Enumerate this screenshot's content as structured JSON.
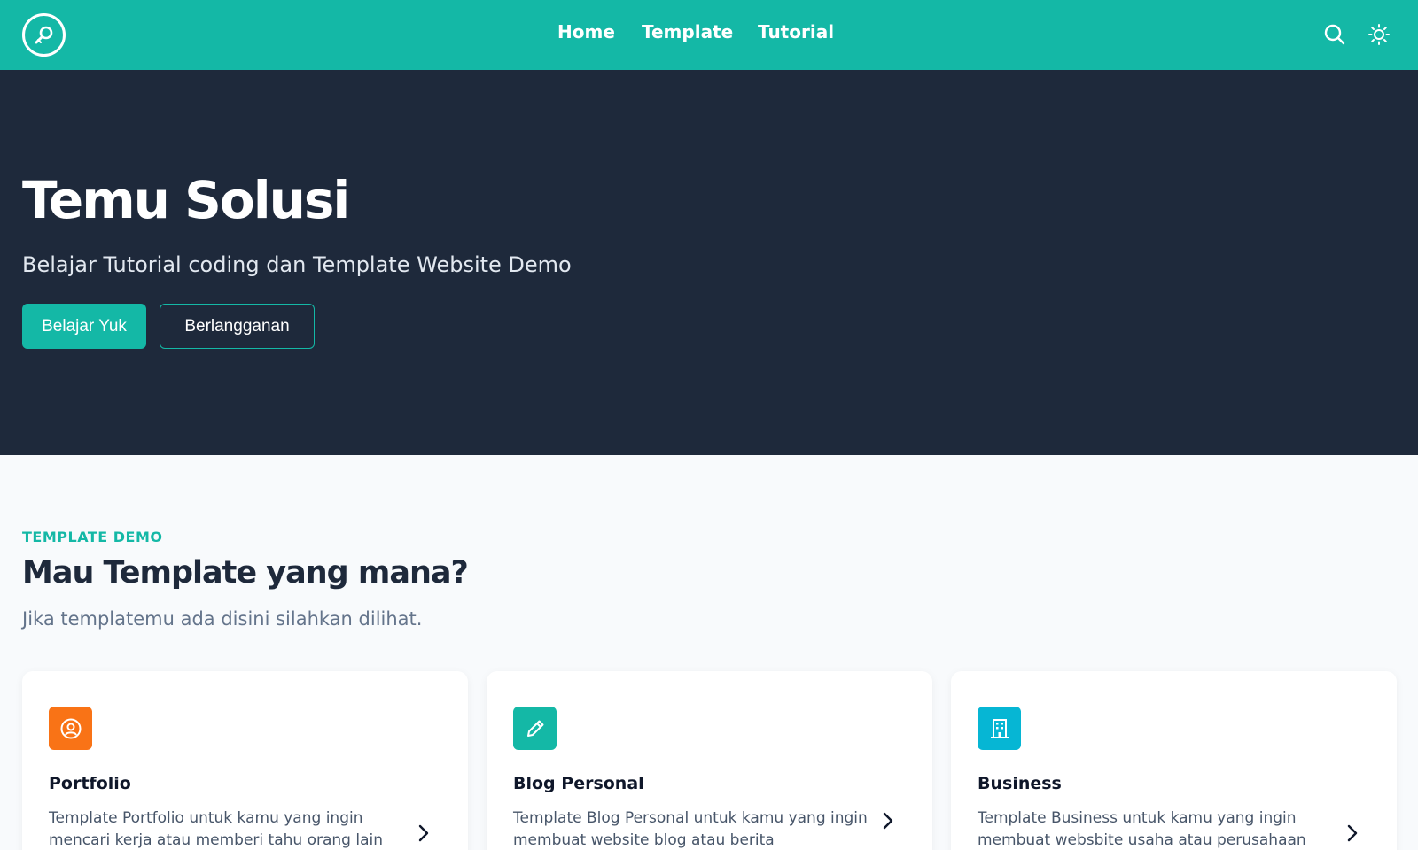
{
  "header": {
    "logo_icon": "lightbulb-icon",
    "nav": [
      {
        "label": "Home"
      },
      {
        "label": "Template"
      },
      {
        "label": "Tutorial"
      }
    ],
    "search_icon": "search-icon",
    "theme_icon": "sun-icon"
  },
  "hero": {
    "title": "Temu Solusi",
    "subtitle": "Belajar Tutorial coding dan Template Website Demo",
    "primary_button": "Belajar Yuk",
    "secondary_button": "Berlangganan"
  },
  "section": {
    "eyebrow": "TEMPLATE DEMO",
    "title": "Mau Template yang mana?",
    "subtitle": "Jika templatemu ada disini silahkan dilihat."
  },
  "cards": [
    {
      "title": "Portfolio",
      "description": "Template Portfolio untuk kamu yang ingin mencari kerja atau memberi tahu orang lain",
      "icon": "user-circle-icon",
      "color": "#f97316"
    },
    {
      "title": "Blog Personal",
      "description": "Template Blog Personal untuk kamu yang ingin membuat website blog atau berita",
      "icon": "pencil-icon",
      "color": "#14b8a6"
    },
    {
      "title": "Business",
      "description": "Template Business untuk kamu yang ingin membuat websbite usaha atau perusahaan",
      "icon": "building-icon",
      "color": "#06b6d4"
    }
  ],
  "colors": {
    "accent": "#14b8a6",
    "hero_bg": "#1e293b",
    "page_bg": "#f8fafc"
  }
}
